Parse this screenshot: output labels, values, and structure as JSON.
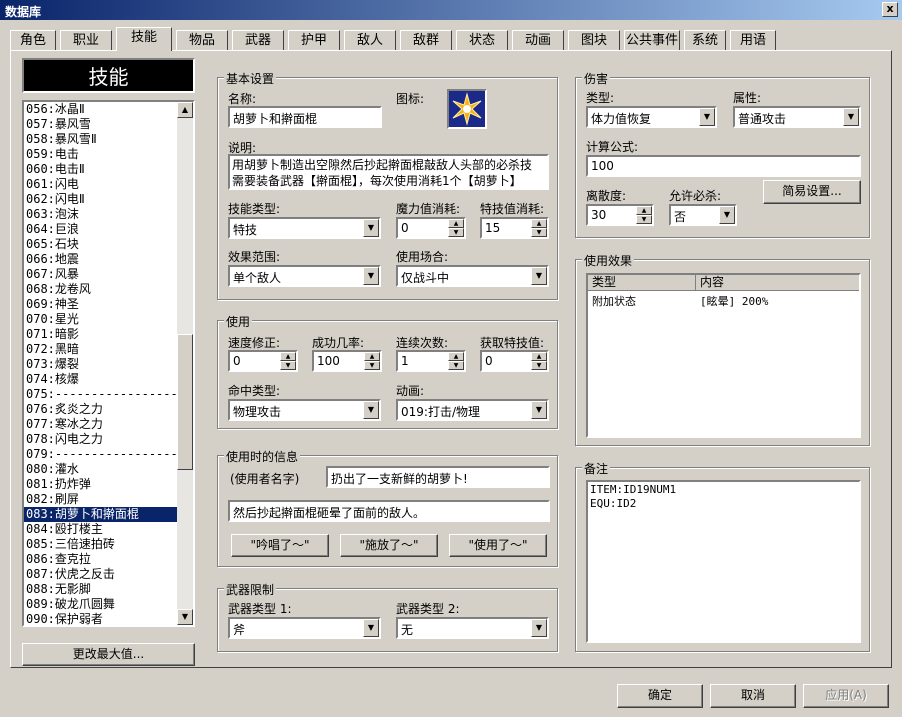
{
  "window": {
    "title": "数据库",
    "close": "x"
  },
  "tabs": [
    "角色",
    "职业",
    "技能",
    "物品",
    "武器",
    "护甲",
    "敌人",
    "敌群",
    "状态",
    "动画",
    "图块",
    "公共事件",
    "系统",
    "用语"
  ],
  "active_tab": 2,
  "skill_header": "技能",
  "skill_list": [
    "056:冰晶Ⅱ",
    "057:暴风雪",
    "058:暴风雪Ⅱ",
    "059:电击",
    "060:电击Ⅱ",
    "061:闪电",
    "062:闪电Ⅱ",
    "063:泡沫",
    "064:巨浪",
    "065:石块",
    "066:地震",
    "067:风暴",
    "068:龙卷风",
    "069:神圣",
    "070:星光",
    "071:暗影",
    "072:黑暗",
    "073:爆裂",
    "074:核爆",
    "075:-------------------",
    "076:炙炎之力",
    "077:寒冰之力",
    "078:闪电之力",
    "079:-------------------",
    "080:灌水",
    "081:扔炸弹",
    "082:刷屏",
    "083:胡萝卜和擀面棍",
    "084:殴打楼主",
    "085:三倍速拍砖",
    "086:查克拉",
    "087:伏虎之反击",
    "088:无影脚",
    "089:破龙爪圆舞",
    "090:保护弱者"
  ],
  "selected_index": 27,
  "change_max_button": "更改最大值...",
  "basic": {
    "group": "基本设置",
    "name_label": "名称:",
    "name_value": "胡萝卜和擀面棍",
    "icon_label": "图标:",
    "desc_label": "说明:",
    "desc_line1": "用胡萝卜制造出空隙然后抄起擀面棍敲敌人头部的必杀技",
    "desc_line2": "需要装备武器【擀面棍】，每次使用消耗1个【胡萝卜】",
    "type_label": "技能类型:",
    "type_value": "特技",
    "mp_label": "魔力值消耗:",
    "mp_value": "0",
    "tp_label": "特技值消耗:",
    "tp_value": "15",
    "scope_label": "效果范围:",
    "scope_value": "单个敌人",
    "occasion_label": "使用场合:",
    "occasion_value": "仅战斗中"
  },
  "invocation": {
    "group": "使用",
    "speed_label": "速度修正:",
    "speed_value": "0",
    "success_label": "成功几率:",
    "success_value": "100",
    "repeat_label": "连续次数:",
    "repeat_value": "1",
    "tp_gain_label": "获取特技值:",
    "tp_gain_value": "0",
    "hit_label": "命中类型:",
    "hit_value": "物理攻击",
    "anim_label": "动画:",
    "anim_value": "019:打击/物理"
  },
  "message": {
    "group": "使用时的信息",
    "user_name": "(使用者名字)",
    "line1": "扔出了一支新鲜的胡萝卜!",
    "line2": "然后抄起擀面棍砸晕了面前的敌人。",
    "btn1": "\"吟唱了～\"",
    "btn2": "\"施放了～\"",
    "btn3": "\"使用了～\""
  },
  "weapon": {
    "group": "武器限制",
    "type1_label": "武器类型 1:",
    "type1_value": "斧",
    "type2_label": "武器类型 2:",
    "type2_value": "无"
  },
  "damage": {
    "group": "伤害",
    "type_label": "类型:",
    "type_value": "体力值恢复",
    "element_label": "属性:",
    "element_value": "普通攻击",
    "formula_label": "计算公式:",
    "formula_value": "100",
    "variance_label": "离散度:",
    "variance_value": "30",
    "critical_label": "允许必杀:",
    "critical_value": "否",
    "simple_button": "简易设置..."
  },
  "effects": {
    "group": "使用效果",
    "col_type": "类型",
    "col_content": "内容",
    "rows": [
      {
        "type": "附加状态",
        "content": "[眩晕] 200%"
      }
    ]
  },
  "note": {
    "group": "备注",
    "lines": [
      "ITEM:ID19NUM1",
      "EQU:ID2"
    ]
  },
  "footer": {
    "ok": "确定",
    "cancel": "取消",
    "apply": "应用(A)"
  },
  "colors": {
    "title_start": "#0a246a",
    "title_end": "#a6caf0",
    "selection": "#0a246a",
    "face": "#d4d0c8"
  }
}
